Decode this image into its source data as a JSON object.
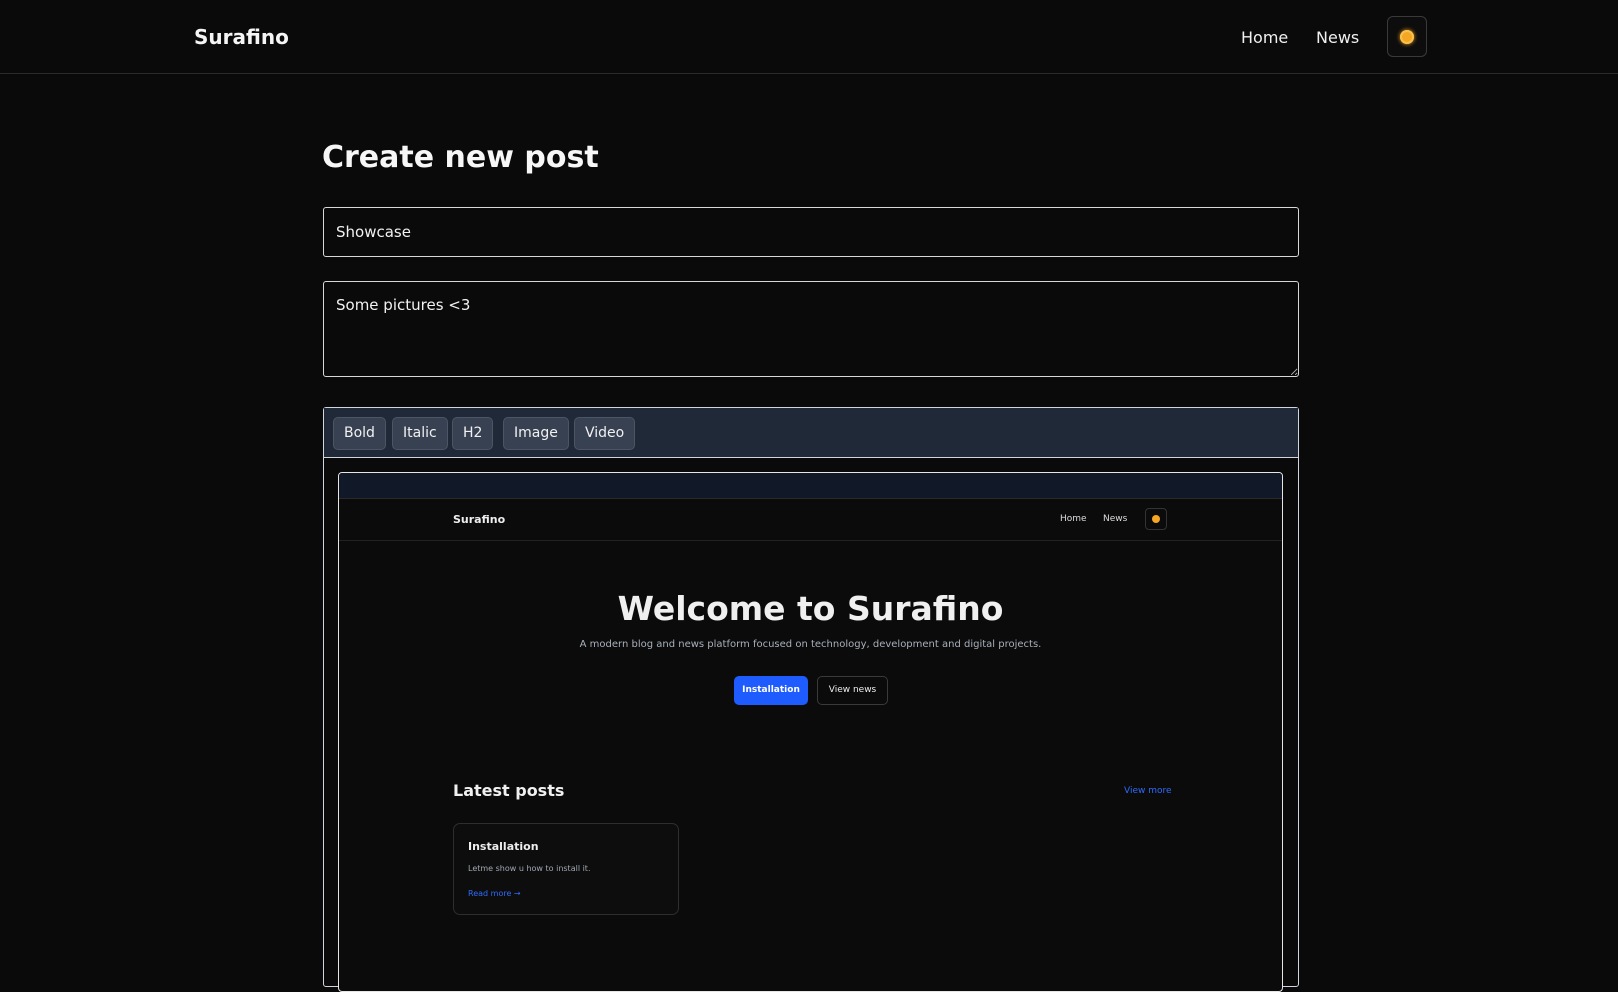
{
  "header": {
    "brand": "Surafino",
    "nav": {
      "home": "Home",
      "news": "News"
    },
    "theme_icon": "sun-icon",
    "theme_color": "#f5a623"
  },
  "page": {
    "title": "Create new post"
  },
  "form": {
    "title_value": "Showcase",
    "description_value": "Some pictures <3"
  },
  "editor": {
    "toolbar": [
      "Bold",
      "Italic",
      "H2",
      "Image",
      "Video"
    ]
  },
  "embedded_screenshot": {
    "brand": "Surafino",
    "nav": {
      "home": "Home",
      "news": "News"
    },
    "hero_title": "Welcome to Surafino",
    "hero_subtitle": "A modern blog and news platform focused on technology, development and digital projects.",
    "buttons": {
      "primary": "Installation",
      "secondary": "View news"
    },
    "latest_title": "Latest posts",
    "view_more": "View more",
    "post": {
      "title": "Installation",
      "description": "Letme show u how to install it.",
      "read_more": "Read more →"
    },
    "accent_color": "#1f5cff"
  }
}
